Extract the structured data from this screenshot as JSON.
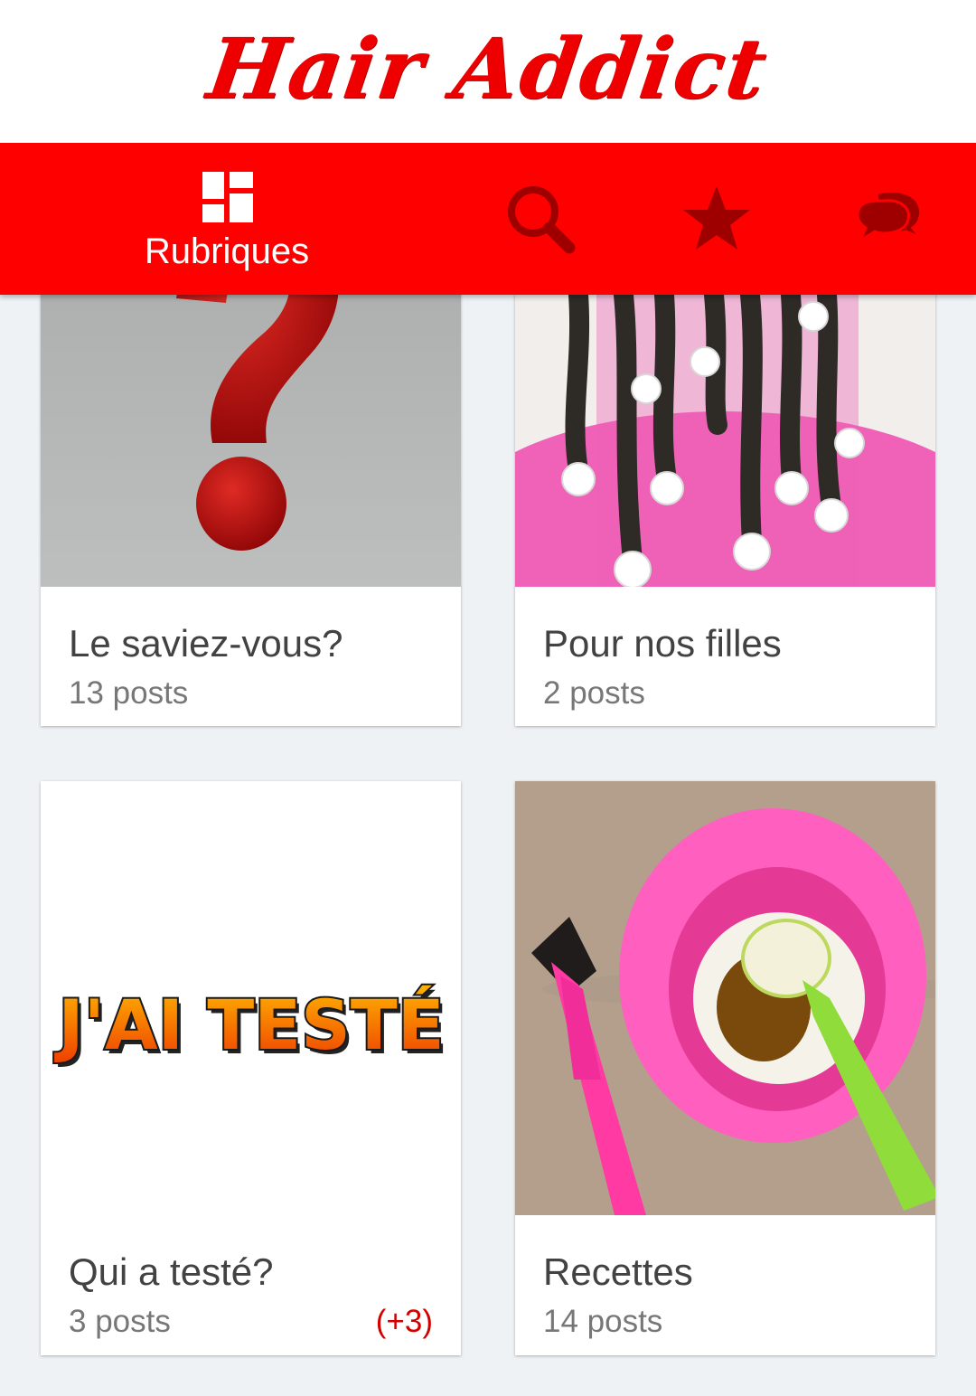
{
  "app": {
    "title": "Hair Addict"
  },
  "nav": {
    "items": [
      {
        "label": "Rubriques",
        "icon": "dashboard-icon",
        "active": true
      },
      {
        "label": "",
        "icon": "search-icon"
      },
      {
        "label": "",
        "icon": "star-icon"
      },
      {
        "label": "",
        "icon": "chat-icon"
      }
    ]
  },
  "categories": [
    {
      "title": "Le saviez-vous?",
      "count": "13 posts",
      "image": "question-mark-image"
    },
    {
      "title": "Pour nos filles",
      "count": "2 posts",
      "image": "girl-braids-image"
    },
    {
      "title": "Qui a testé?",
      "count": "3 posts",
      "badge": "(+3)",
      "image": "jai-teste-image",
      "image_text": "J'AI TESTÉ"
    },
    {
      "title": "Recettes",
      "count": "14 posts",
      "image": "hair-mask-bowl-image"
    }
  ],
  "colors": {
    "primary": "#ff0000",
    "logo": "#ee0000",
    "inactive_icon": "#9e0000",
    "badge": "#d40000",
    "background": "#eef2f5"
  }
}
